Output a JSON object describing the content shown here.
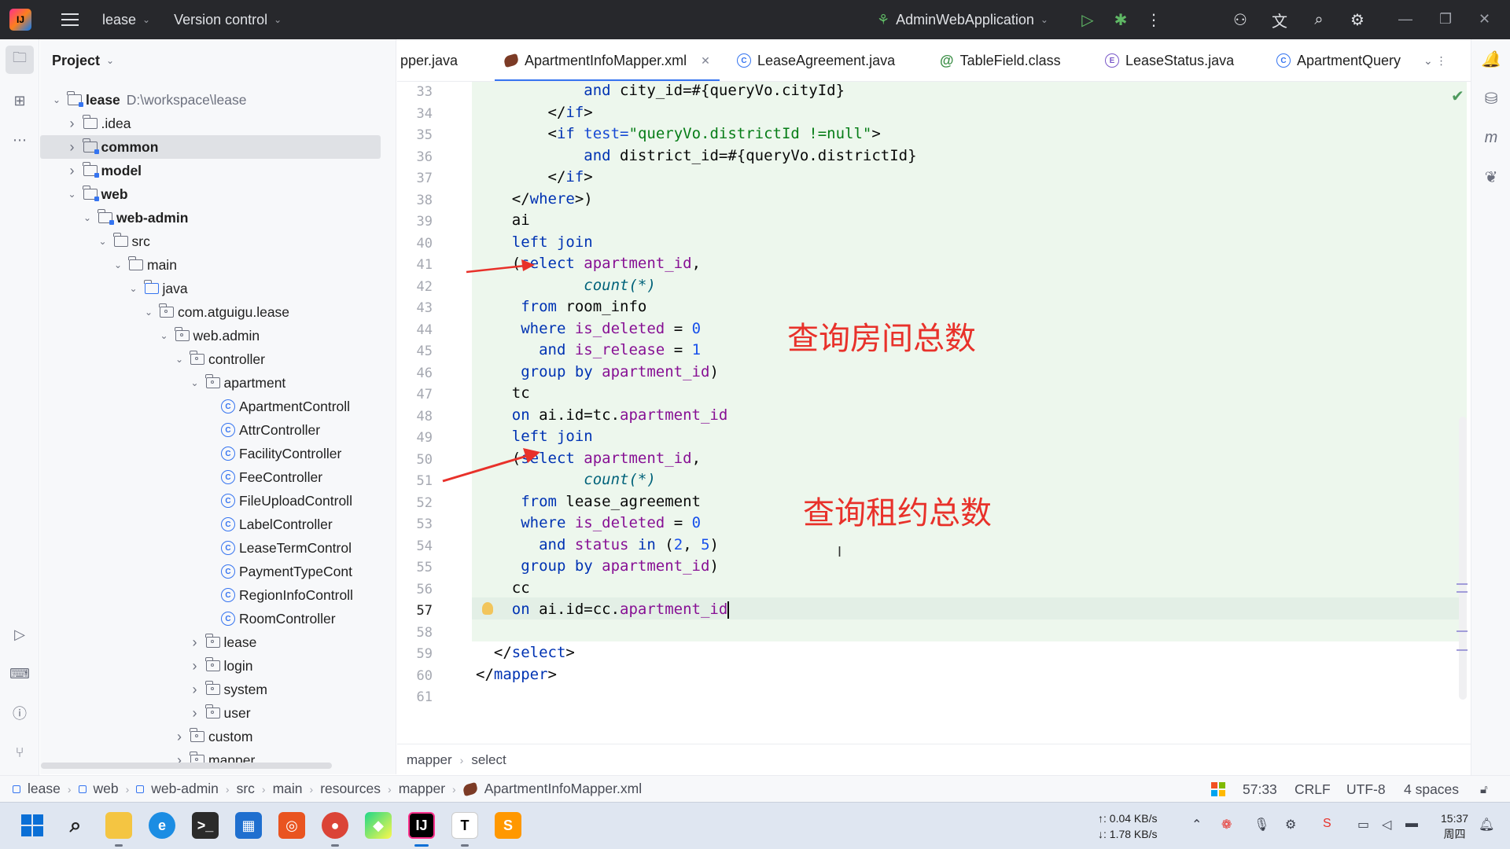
{
  "titlebar": {
    "project": "lease",
    "vcs": "Version control",
    "run_config": "AdminWebApplication"
  },
  "project_panel": {
    "title": "Project",
    "tree": [
      {
        "label": "lease",
        "path": "D:\\workspace\\lease",
        "depth": 0,
        "expanded": true,
        "icon": "module-folder-icon",
        "bold": true
      },
      {
        "label": ".idea",
        "depth": 1,
        "expanded": false,
        "icon": "folder-icon"
      },
      {
        "label": "common",
        "depth": 1,
        "expanded": false,
        "icon": "module-folder-icon",
        "bold": true,
        "selected": true
      },
      {
        "label": "model",
        "depth": 1,
        "expanded": false,
        "icon": "module-folder-icon",
        "bold": true
      },
      {
        "label": "web",
        "depth": 1,
        "expanded": true,
        "icon": "module-folder-icon",
        "bold": true
      },
      {
        "label": "web-admin",
        "depth": 2,
        "expanded": true,
        "icon": "module-folder-icon",
        "bold": true
      },
      {
        "label": "src",
        "depth": 3,
        "expanded": true,
        "icon": "folder-icon"
      },
      {
        "label": "main",
        "depth": 4,
        "expanded": true,
        "icon": "folder-icon"
      },
      {
        "label": "java",
        "depth": 5,
        "expanded": true,
        "icon": "source-folder-icon"
      },
      {
        "label": "com.atguigu.lease",
        "depth": 6,
        "expanded": true,
        "icon": "package-icon"
      },
      {
        "label": "web.admin",
        "depth": 7,
        "expanded": true,
        "icon": "package-icon"
      },
      {
        "label": "controller",
        "depth": 8,
        "expanded": true,
        "icon": "package-icon"
      },
      {
        "label": "apartment",
        "depth": 9,
        "expanded": true,
        "icon": "package-icon"
      },
      {
        "label": "ApartmentControll",
        "depth": 10,
        "icon": "class-icon"
      },
      {
        "label": "AttrController",
        "depth": 10,
        "icon": "class-icon"
      },
      {
        "label": "FacilityController",
        "depth": 10,
        "icon": "class-icon"
      },
      {
        "label": "FeeController",
        "depth": 10,
        "icon": "class-icon"
      },
      {
        "label": "FileUploadControll",
        "depth": 10,
        "icon": "class-icon"
      },
      {
        "label": "LabelController",
        "depth": 10,
        "icon": "class-icon"
      },
      {
        "label": "LeaseTermControl",
        "depth": 10,
        "icon": "class-icon"
      },
      {
        "label": "PaymentTypeCont",
        "depth": 10,
        "icon": "class-icon"
      },
      {
        "label": "RegionInfoControll",
        "depth": 10,
        "icon": "class-icon"
      },
      {
        "label": "RoomController",
        "depth": 10,
        "icon": "class-icon"
      },
      {
        "label": "lease",
        "depth": 9,
        "expanded": false,
        "icon": "package-icon"
      },
      {
        "label": "login",
        "depth": 9,
        "expanded": false,
        "icon": "package-icon"
      },
      {
        "label": "system",
        "depth": 9,
        "expanded": false,
        "icon": "package-icon"
      },
      {
        "label": "user",
        "depth": 9,
        "expanded": false,
        "icon": "package-icon"
      },
      {
        "label": "custom",
        "depth": 8,
        "expanded": false,
        "icon": "package-icon"
      },
      {
        "label": "mapper",
        "depth": 8,
        "expanded": false,
        "icon": "package-icon"
      }
    ]
  },
  "tabs": [
    {
      "label": "pper.java",
      "icon": "class-icon"
    },
    {
      "label": "ApartmentInfoMapper.xml",
      "icon": "mybatis-xml-icon",
      "active": true
    },
    {
      "label": "LeaseAgreement.java",
      "icon": "class-icon"
    },
    {
      "label": "TableField.class",
      "icon": "annotation-icon"
    },
    {
      "label": "LeaseStatus.java",
      "icon": "enum-icon"
    },
    {
      "label": "ApartmentQuery",
      "icon": "class-icon"
    }
  ],
  "editor": {
    "first_line": 33,
    "current_line": 57,
    "lines": [
      "            and city_id=#{queryVo.cityId}",
      "        </if>",
      "        <if test=\"queryVo.districtId !=null\">",
      "            and district_id=#{queryVo.districtId}",
      "        </if>",
      "    </where>)",
      "    ai",
      "    left join",
      "    (select apartment_id,",
      "            count(*)",
      "     from room_info",
      "     where is_deleted = 0",
      "       and is_release = 1",
      "     group by apartment_id)",
      "    tc",
      "    on ai.id=tc.apartment_id",
      "    left join",
      "    (select apartment_id,",
      "            count(*)",
      "     from lease_agreement",
      "     where is_deleted = 0",
      "       and status in (2, 5)",
      "     group by apartment_id)",
      "    cc",
      "    on ai.id=cc.apartment_id",
      "",
      "  </select>",
      "</mapper>",
      ""
    ],
    "annotations": [
      "查询房间总数",
      "查询租约总数"
    ],
    "annotation_color": "#e8312a"
  },
  "breadcrumb": [
    "mapper",
    "select"
  ],
  "statusbar": {
    "path": [
      "lease",
      "web",
      "web-admin",
      "src",
      "main",
      "resources",
      "mapper",
      "ApartmentInfoMapper.xml"
    ],
    "position": "57:33",
    "line_sep": "CRLF",
    "encoding": "UTF-8",
    "indent": "4 spaces"
  },
  "taskbar": {
    "upload": "↑: 0.04 KB/s",
    "download": "↓: 1.78 KB/s",
    "time": "15:37",
    "day": "周四",
    "apps": [
      "start-icon",
      "search-icon",
      "file-explorer-icon",
      "edge-icon",
      "terminal-icon",
      "store-icon",
      "ubuntu-icon",
      "chrome-icon",
      "pycharm-icon",
      "intellij-icon",
      "typora-icon",
      "sublime-icon"
    ]
  }
}
